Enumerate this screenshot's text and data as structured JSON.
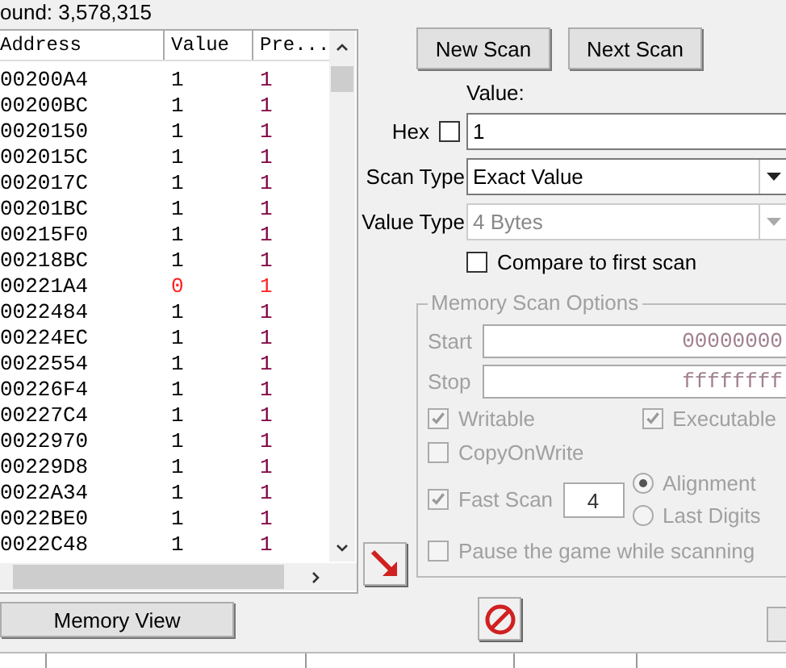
{
  "found_label": "ound: 3,578,315",
  "results": {
    "columns": [
      "Address",
      "Value",
      "Pre..."
    ],
    "rows": [
      {
        "address": "00200A4",
        "value": "1",
        "previous": "1",
        "changed": false
      },
      {
        "address": "00200BC",
        "value": "1",
        "previous": "1",
        "changed": false
      },
      {
        "address": "0020150",
        "value": "1",
        "previous": "1",
        "changed": false
      },
      {
        "address": "002015C",
        "value": "1",
        "previous": "1",
        "changed": false
      },
      {
        "address": "002017C",
        "value": "1",
        "previous": "1",
        "changed": false
      },
      {
        "address": "00201BC",
        "value": "1",
        "previous": "1",
        "changed": false
      },
      {
        "address": "00215F0",
        "value": "1",
        "previous": "1",
        "changed": false
      },
      {
        "address": "00218BC",
        "value": "1",
        "previous": "1",
        "changed": false
      },
      {
        "address": "00221A4",
        "value": "0",
        "previous": "1",
        "changed": true
      },
      {
        "address": "0022484",
        "value": "1",
        "previous": "1",
        "changed": false
      },
      {
        "address": "00224EC",
        "value": "1",
        "previous": "1",
        "changed": false
      },
      {
        "address": "0022554",
        "value": "1",
        "previous": "1",
        "changed": false
      },
      {
        "address": "00226F4",
        "value": "1",
        "previous": "1",
        "changed": false
      },
      {
        "address": "00227C4",
        "value": "1",
        "previous": "1",
        "changed": false
      },
      {
        "address": "0022970",
        "value": "1",
        "previous": "1",
        "changed": false
      },
      {
        "address": "00229D8",
        "value": "1",
        "previous": "1",
        "changed": false
      },
      {
        "address": "0022A34",
        "value": "1",
        "previous": "1",
        "changed": false
      },
      {
        "address": "0022BE0",
        "value": "1",
        "previous": "1",
        "changed": false
      },
      {
        "address": "0022C48",
        "value": "1",
        "previous": "1",
        "changed": false
      }
    ]
  },
  "buttons": {
    "new_scan": "New Scan",
    "next_scan": "Next Scan",
    "memory_view": "Memory View"
  },
  "value": {
    "label": "Value:",
    "hex_label": "Hex",
    "hex_checked": false,
    "input": "1"
  },
  "scan_type": {
    "label": "Scan Type",
    "value": "Exact Value",
    "disabled": false
  },
  "value_type": {
    "label": "Value Type",
    "value": "4 Bytes",
    "disabled": true
  },
  "compare_first": {
    "label": "Compare to first scan",
    "checked": false
  },
  "memory_options": {
    "title": "Memory Scan Options",
    "disabled": true,
    "start_label": "Start",
    "start": "00000000",
    "stop_label": "Stop",
    "stop": "ffffffff",
    "writable": {
      "label": "Writable",
      "checked": true
    },
    "executable": {
      "label": "Executable",
      "checked": true
    },
    "copy_on_write": {
      "label": "CopyOnWrite",
      "checked": false
    },
    "fast_scan": {
      "label": "Fast Scan",
      "checked": true,
      "value": "4"
    },
    "alignment": [
      {
        "label": "Alignment",
        "selected": true
      },
      {
        "label": "Last Digits",
        "selected": false
      }
    ],
    "pause": {
      "label": "Pause the game while scanning",
      "checked": false
    }
  }
}
